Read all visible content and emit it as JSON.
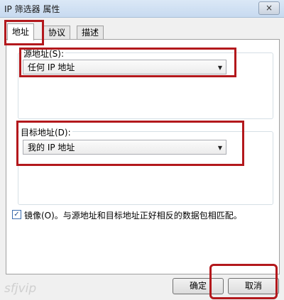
{
  "window": {
    "title": "IP 筛选器 属性",
    "close_icon": "×"
  },
  "tabs": [
    {
      "label": "地址",
      "active": true
    },
    {
      "label": "协议",
      "active": false
    },
    {
      "label": "描述",
      "active": false
    }
  ],
  "source": {
    "label": "源地址(S):",
    "selected": "任何 IP 地址"
  },
  "destination": {
    "label": "目标地址(D):",
    "selected": "我的 IP 地址"
  },
  "mirror": {
    "checked": true,
    "check_glyph": "✓",
    "label": "镜像(O)。与源地址和目标地址正好相反的数据包相匹配。"
  },
  "buttons": {
    "ok": "确定",
    "cancel": "取消"
  },
  "watermark": "sfjvip",
  "icons": {
    "dropdown": "chevron-down-icon",
    "close": "close-icon",
    "check": "checkmark-icon"
  },
  "colors": {
    "highlight": "#b3181c",
    "titlebar": "#c7daf0"
  }
}
